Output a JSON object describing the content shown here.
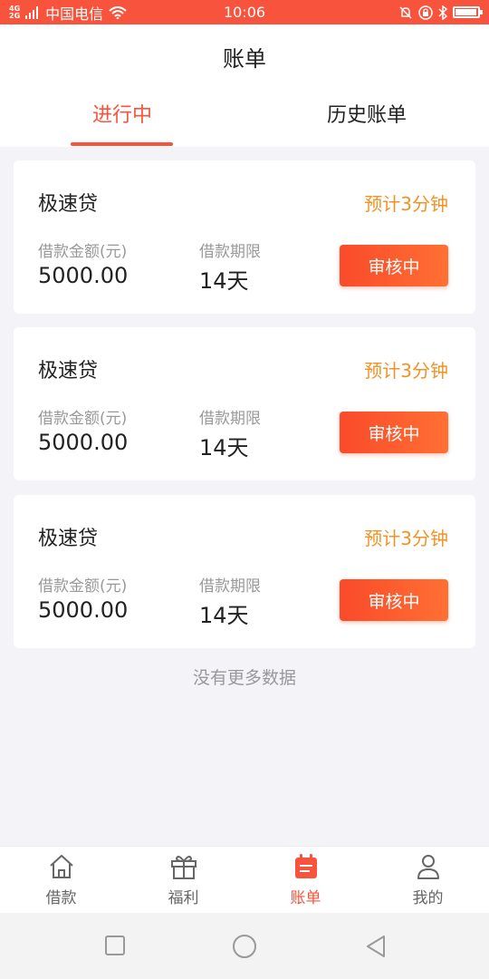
{
  "status_bar": {
    "network": "4G\n2G",
    "carrier": "中国电信",
    "time": "10:06",
    "icons": [
      "signal-icon",
      "wifi-icon",
      "alarm-off-icon",
      "lock-rotation-icon",
      "bluetooth-icon",
      "battery-icon"
    ],
    "battery_level": 0.9
  },
  "header": {
    "title": "账单",
    "tabs": [
      {
        "label": "进行中",
        "active": true
      },
      {
        "label": "历史账单",
        "active": false
      }
    ]
  },
  "bills": [
    {
      "name": "极速贷",
      "eta": "预计3分钟",
      "amount_label": "借款金额(元)",
      "amount": "5000.00",
      "term_label": "借款期限",
      "term": "14天",
      "status": "审核中"
    },
    {
      "name": "极速贷",
      "eta": "预计3分钟",
      "amount_label": "借款金额(元)",
      "amount": "5000.00",
      "term_label": "借款期限",
      "term": "14天",
      "status": "审核中"
    },
    {
      "name": "极速贷",
      "eta": "预计3分钟",
      "amount_label": "借款金额(元)",
      "amount": "5000.00",
      "term_label": "借款期限",
      "term": "14天",
      "status": "审核中"
    }
  ],
  "no_more": "没有更多数据",
  "tabbar": {
    "items": [
      {
        "label": "借款",
        "icon": "home-icon",
        "active": false
      },
      {
        "label": "福利",
        "icon": "gift-icon",
        "active": false
      },
      {
        "label": "账单",
        "icon": "bill-icon",
        "active": true
      },
      {
        "label": "我的",
        "icon": "user-icon",
        "active": false
      }
    ]
  },
  "colors": {
    "accent": "#f8533d",
    "eta": "#f29225",
    "background": "#f3f3f8"
  }
}
